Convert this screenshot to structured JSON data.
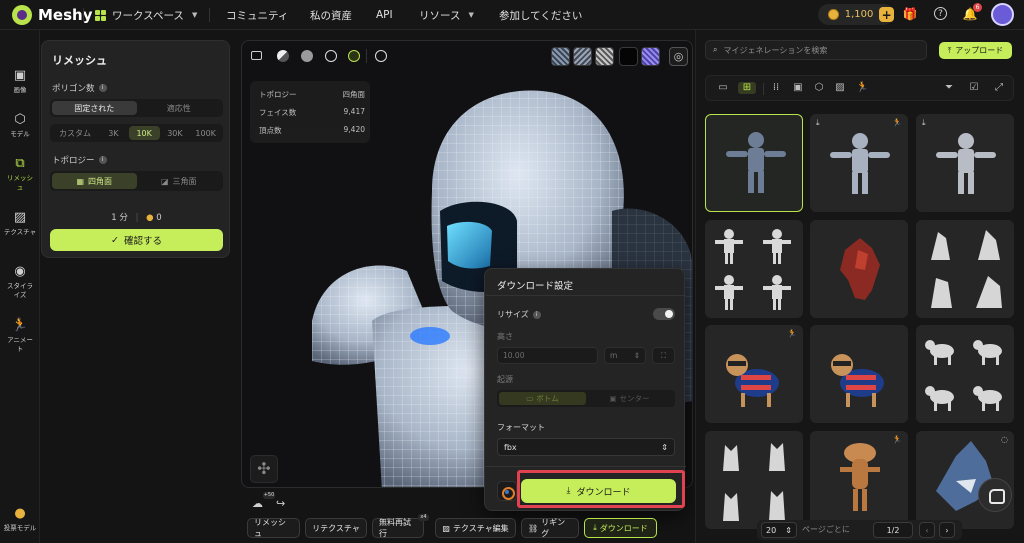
{
  "topbar": {
    "logo": "Meshy",
    "nav": [
      "ワークスペース",
      "コミュニティ",
      "私の資産",
      "API",
      "リソース",
      "参加してください"
    ],
    "credits": "1,100",
    "plus": "+",
    "notification_count": "6"
  },
  "rail": {
    "items": [
      "画像",
      "モデル",
      "リメッシュ",
      "テクスチャ",
      "スタイライズ",
      "アニメート"
    ],
    "bottom": "投票モデル"
  },
  "remesh": {
    "title": "リメッシュ",
    "polycount_label": "ポリゴン数",
    "mode_fixed": "固定された",
    "mode_adaptive": "適応性",
    "counts": [
      "カスタム",
      "3K",
      "10K",
      "30K",
      "100K"
    ],
    "topology_label": "トポロジー",
    "quad": "四角面",
    "tri": "三角面",
    "time": "1 分",
    "cost": "0",
    "confirm": "確認する"
  },
  "stats": {
    "topology_label": "トポロジー",
    "topology_value": "四角面",
    "faces_label": "フェイス数",
    "faces_value": "9,417",
    "verts_label": "頂点数",
    "verts_value": "9,420"
  },
  "download": {
    "title": "ダウンロード設定",
    "resize_label": "リサイズ",
    "height_label": "高さ",
    "height_value": "10.00",
    "unit": "m",
    "origin_label": "起源",
    "origin_bottom": "ボトム",
    "origin_center": "センター",
    "format_label": "フォーマット",
    "format_value": "fbx",
    "button": "ダウンロード"
  },
  "actions": {
    "plus50": "+50",
    "remesh": "リメッシュ",
    "retexture": "リテクスチャ",
    "free_retry": "無料再試行",
    "x4": "x4",
    "edit_texture": "テクスチャ編集",
    "rigging": "リギング",
    "download": "ダウンロード"
  },
  "right": {
    "search_placeholder": "マイジェネレーションを検索",
    "upload": "アップロード",
    "per_page": "20",
    "per_page_label": "ページごとに",
    "page": "1/2"
  }
}
